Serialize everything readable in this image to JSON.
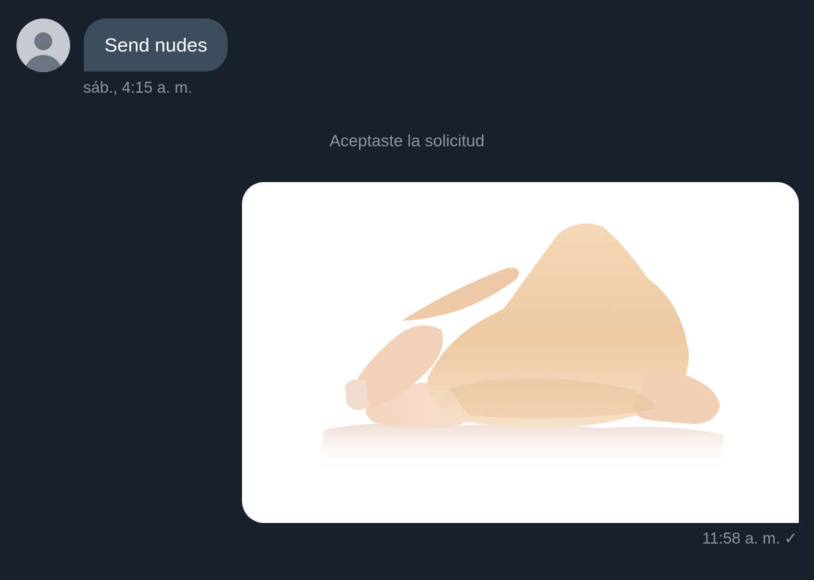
{
  "messages": [
    {
      "direction": "incoming",
      "text": "Send nudes",
      "timestamp": "sáb., 4:15 a. m.",
      "sender_avatar": "default-user-avatar"
    },
    {
      "direction": "outgoing",
      "attachment": "photo",
      "timestamp": "11:58 a. m.",
      "status_icon": "checkmark-icon",
      "status_glyph": "✓"
    }
  ],
  "system_note": "Aceptaste la solicitud",
  "colors": {
    "background": "#18202b",
    "incoming_bubble": "#3c4d5e",
    "muted_text": "#8a96a3",
    "photo_bubble": "#ffffff"
  }
}
